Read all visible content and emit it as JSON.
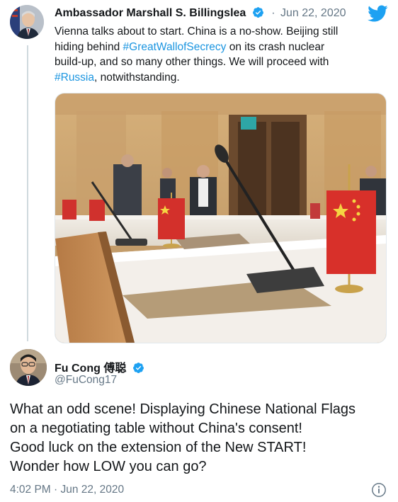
{
  "quoted_tweet": {
    "author_name": "Ambassador Marshall S. Billingslea",
    "separator": "·",
    "date": "Jun 22, 2020",
    "text_lines": [
      [
        "Vienna talks about to start. China is a no-show. Beijing still"
      ],
      [
        "hiding behind ",
        "#GreatWallofSecrecy",
        " on its crash nuclear"
      ],
      [
        "build-up, and so many other things. We will proceed with"
      ],
      [
        "#Russia",
        ", notwithstanding."
      ]
    ],
    "text_part1": "Vienna talks about to start. China is a no-show. Beijing still hiding behind ",
    "hashtag1": "#GreatWallofSecrecy",
    "text_part2": " on its crash nuclear build-up, and so many other things. We will proceed with ",
    "hashtag2": "#Russia",
    "text_part3": ", notwithstanding.",
    "verified_icon": "verified-badge-icon",
    "brand_icon": "twitter-bird-icon",
    "media": "photo of a negotiating table with Chinese national flags"
  },
  "reply_tweet": {
    "author_name": "Fu Cong 傅聪",
    "handle": "@FuCong17",
    "text_lines": [
      "What an odd scene! Displaying Chinese National Flags",
      "on a negotiating table without China's consent!",
      "Good luck on the extension of the New START!",
      "Wonder how LOW you can go?"
    ],
    "timestamp": "4:02 PM · Jun 22, 2020",
    "verified_icon": "verified-badge-icon",
    "info_icon": "info-icon"
  },
  "colors": {
    "accent": "#1DA1F2",
    "link": "#1B95E0",
    "text": "#14171A",
    "muted": "#657786"
  }
}
